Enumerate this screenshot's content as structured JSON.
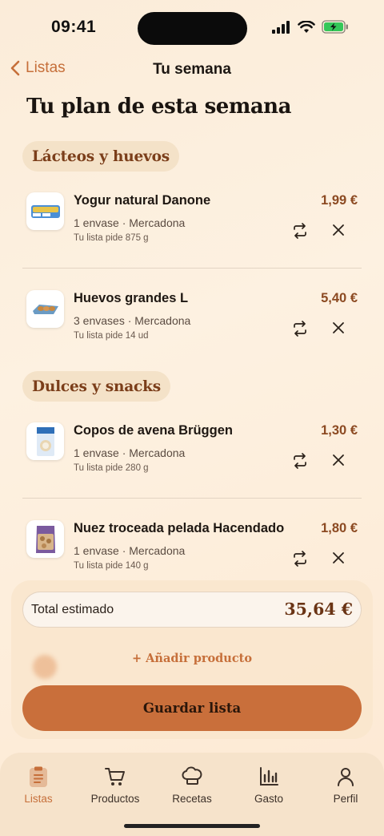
{
  "status_bar": {
    "time": "09:41"
  },
  "nav": {
    "back_label": "Listas",
    "title": "Tu semana"
  },
  "page": {
    "title": "Tu plan de esta semana"
  },
  "categories": [
    {
      "name": "Lácteos y huevos",
      "items": [
        {
          "name": "Yogur natural Danone",
          "qty": "1 envase · Mercadona",
          "note": "Tu lista pide 875 g",
          "price": "1,99 €",
          "icon": "yogurt-pack-icon"
        },
        {
          "name": "Huevos grandes L",
          "qty": "3 envases · Mercadona",
          "note": "Tu lista pide 14 ud",
          "price": "5,40 €",
          "icon": "egg-carton-icon"
        }
      ]
    },
    {
      "name": "Dulces y snacks",
      "items": [
        {
          "name": "Copos de avena Brüggen",
          "qty": "1 envase · Mercadona",
          "note": "Tu lista pide 280 g",
          "price": "1,30 €",
          "icon": "oat-box-icon"
        },
        {
          "name": "Nuez troceada pelada Hacendado",
          "qty": "1 envase · Mercadona",
          "note": "Tu lista pide 140 g",
          "price": "1,80 €",
          "icon": "walnut-bag-icon"
        }
      ]
    }
  ],
  "summary": {
    "total_label": "Total estimado",
    "total_value": "35,64 €"
  },
  "actions": {
    "add_product": "+ Añadir producto",
    "save": "Guardar lista"
  },
  "tabbar": {
    "tabs": [
      {
        "label": "Listas",
        "icon": "clipboard-icon",
        "active": true
      },
      {
        "label": "Productos",
        "icon": "cart-icon",
        "active": false
      },
      {
        "label": "Recetas",
        "icon": "chef-hat-icon",
        "active": false
      },
      {
        "label": "Gasto",
        "icon": "bar-chart-icon",
        "active": false
      },
      {
        "label": "Perfil",
        "icon": "user-icon",
        "active": false
      }
    ]
  },
  "colors": {
    "accent": "#c66f3a",
    "price": "#8c4a22",
    "category_text": "#7b3e1a",
    "save_button": "#c96f3b"
  }
}
